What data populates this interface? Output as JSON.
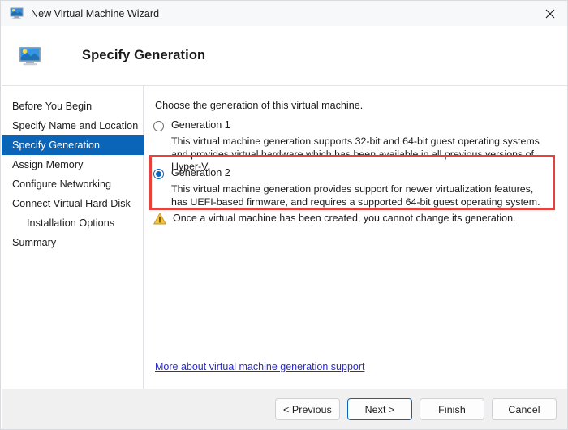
{
  "titlebar": {
    "title": "New Virtual Machine Wizard",
    "icon": "virtual-machine-icon",
    "close_label": "✕"
  },
  "header": {
    "title": "Specify Generation",
    "icon": "virtual-machine-icon"
  },
  "sidebar": {
    "items": [
      {
        "label": "Before You Begin",
        "selected": false,
        "indented": false
      },
      {
        "label": "Specify Name and Location",
        "selected": false,
        "indented": false
      },
      {
        "label": "Specify Generation",
        "selected": true,
        "indented": false
      },
      {
        "label": "Assign Memory",
        "selected": false,
        "indented": false
      },
      {
        "label": "Configure Networking",
        "selected": false,
        "indented": false
      },
      {
        "label": "Connect Virtual Hard Disk",
        "selected": false,
        "indented": false
      },
      {
        "label": "Installation Options",
        "selected": false,
        "indented": true
      },
      {
        "label": "Summary",
        "selected": false,
        "indented": false
      }
    ],
    "selected_color": "#0a65b8"
  },
  "content": {
    "intro": "Choose the generation of this virtual machine.",
    "options": [
      {
        "label": "Generation 1",
        "checked": false,
        "description": "This virtual machine generation supports 32-bit and 64-bit guest operating systems and provides virtual hardware which has been available in all previous versions of Hyper-V."
      },
      {
        "label": "Generation 2",
        "checked": true,
        "description": "This virtual machine generation provides support for newer virtualization features, has UEFI-based firmware, and requires a supported 64-bit guest operating system."
      }
    ],
    "warning": {
      "icon": "warning-triangle-icon",
      "text": "Once a virtual machine has been created, you cannot change its generation."
    },
    "link": "More about virtual machine generation support",
    "highlight_color": "#e8403a"
  },
  "footer": {
    "buttons": [
      {
        "label": "< Previous",
        "default": false
      },
      {
        "label": "Next >",
        "default": true
      },
      {
        "label": "Finish",
        "default": false
      },
      {
        "label": "Cancel",
        "default": false
      }
    ]
  }
}
